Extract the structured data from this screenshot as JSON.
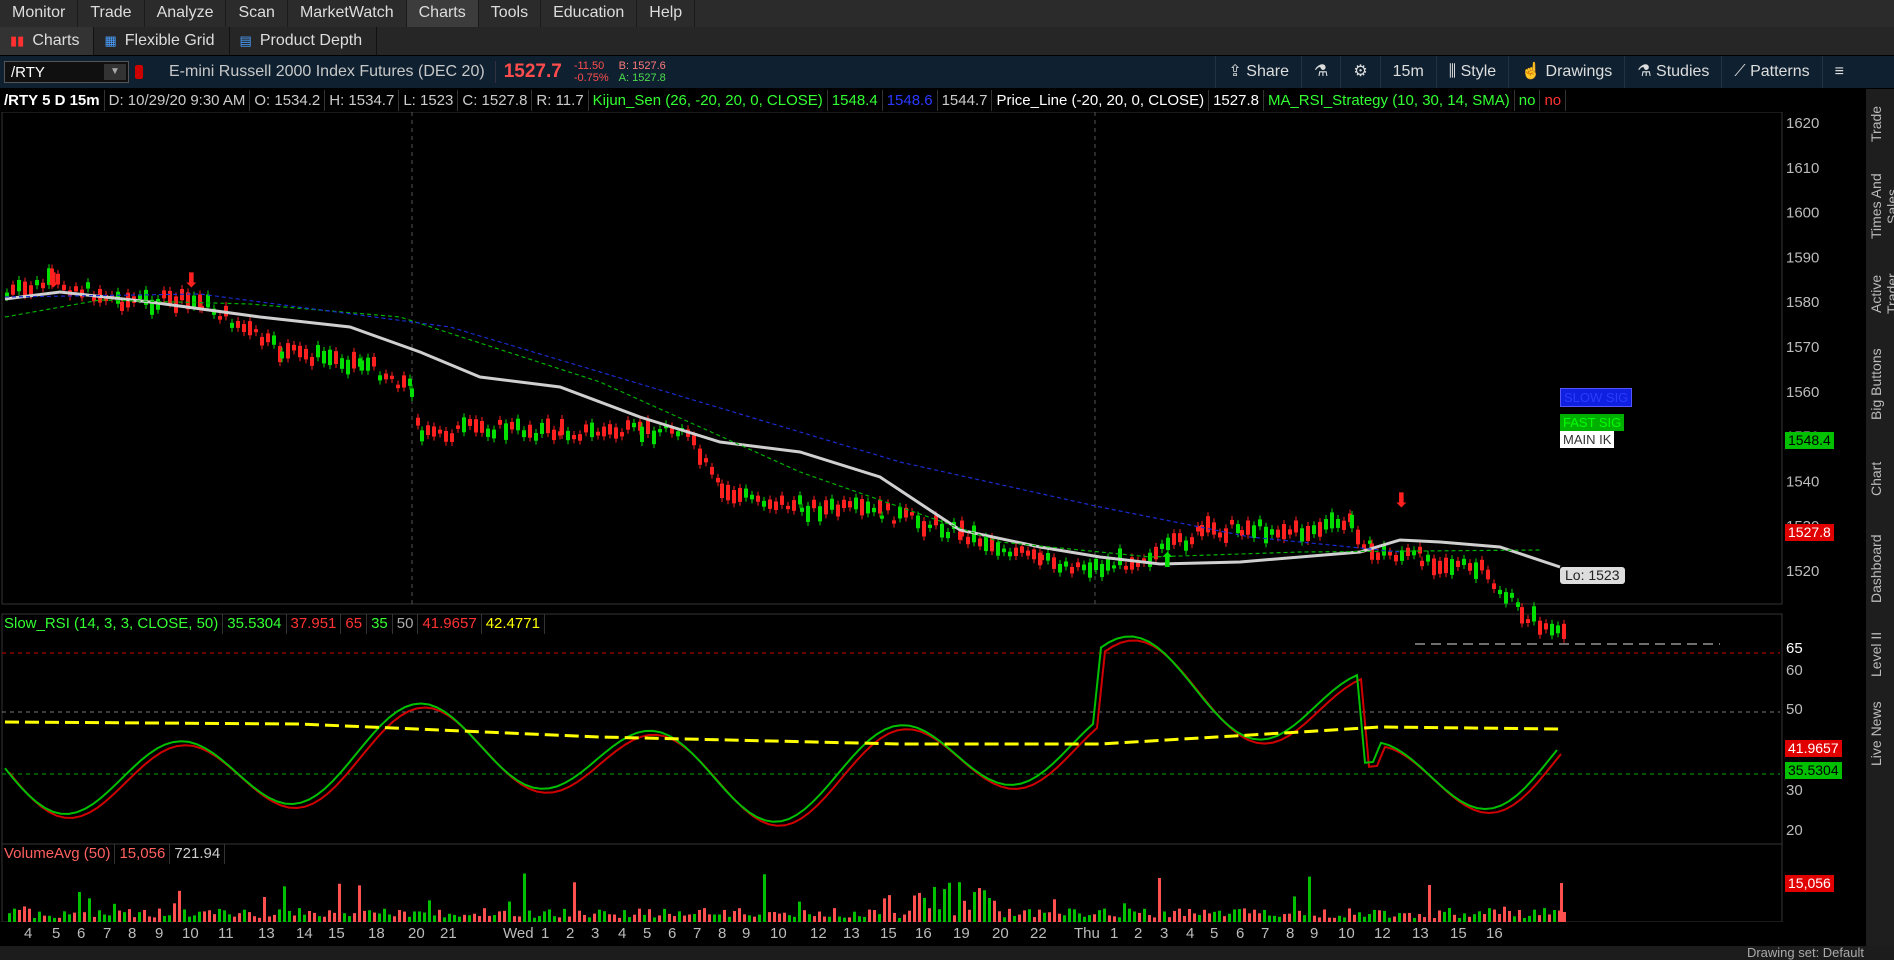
{
  "menu": [
    "Monitor",
    "Trade",
    "Analyze",
    "Scan",
    "MarketWatch",
    "Charts",
    "Tools",
    "Education",
    "Help"
  ],
  "active_menu": "Charts",
  "subtabs": [
    {
      "label": "Charts",
      "icon": "bar-chart-icon"
    },
    {
      "label": "Flexible Grid",
      "icon": "grid-icon"
    },
    {
      "label": "Product Depth",
      "icon": "depth-icon"
    }
  ],
  "toolbar": {
    "symbol": "/RTY",
    "description": "E-mini Russell 2000 Index Futures (DEC 20)",
    "last": "1527.7",
    "change": "-11.50",
    "change_pct": "-0.75%",
    "bid": "B: 1527.6",
    "ask": "A: 1527.8",
    "share": "Share",
    "timeframe": "15m",
    "style": "Style",
    "drawings": "Drawings",
    "studies": "Studies",
    "patterns": "Patterns"
  },
  "info": {
    "title": "/RTY 5 D 15m",
    "date": "D: 10/29/20 9:30 AM",
    "open": "O: 1534.2",
    "high": "H: 1534.7",
    "low": "L: 1523",
    "close": "C: 1527.8",
    "range": "R: 11.7",
    "kijun": "Kijun_Sen (26, -20, 20, 0, CLOSE)",
    "kijun_v1": "1548.4",
    "kijun_v2": "1548.6",
    "kijun_v3": "1544.7",
    "price_line": "Price_Line (-20, 20, 0, CLOSE)",
    "price_line_v": "1527.8",
    "strategy": "MA_RSI_Strategy (10, 30, 14, SMA)",
    "strategy_v1": "no",
    "strategy_v2": "no"
  },
  "price_axis": [
    "1620",
    "1610",
    "1600",
    "1590",
    "1580",
    "1570",
    "1560",
    "1550",
    "1540",
    "1530",
    "1520"
  ],
  "tags": {
    "kijun": "1548.4",
    "last": "1527.8",
    "low": "Lo: 1523",
    "slow": "SLOW SIG",
    "fast": "FAST SIG",
    "main": "MAIN IK"
  },
  "rsi": {
    "label": "Slow_RSI (14, 3, 3, CLOSE, 50)",
    "v1": "35.5304",
    "v2": "37.951",
    "v3": "65",
    "v4": "35",
    "v5": "50",
    "v6": "41.9657",
    "v7": "42.4771",
    "axis": [
      "65",
      "60",
      "50",
      "30",
      "20"
    ],
    "tag_red": "41.9657",
    "tag_green": "35.5304"
  },
  "volume": {
    "label": "VolumeAvg (50)",
    "v1": "15,056",
    "v2": "721.94",
    "tag": "15,056"
  },
  "x_axis": [
    "4",
    "5",
    "6",
    "7",
    "8",
    "9",
    "10",
    "11",
    "13",
    "14",
    "15",
    "18",
    "20",
    "21",
    "Wed",
    "1",
    "2",
    "3",
    "4",
    "5",
    "6",
    "7",
    "8",
    "9",
    "10",
    "12",
    "13",
    "15",
    "16",
    "19",
    "20",
    "22",
    "Thu",
    "1",
    "2",
    "3",
    "4",
    "5",
    "6",
    "7",
    "8",
    "9",
    "10",
    "12",
    "13",
    "15",
    "16"
  ],
  "side_tabs": [
    "Trade",
    "Times And Sales",
    "Active Trader",
    "Big Buttons",
    "Chart",
    "Dashboard",
    "Level II",
    "Live News"
  ],
  "bottom": {
    "drawing_set": "Drawing set: Default"
  },
  "colors": {
    "up": "#00d000",
    "down": "#ff2020",
    "kijun": "#cfcfcf",
    "yellow": "#ffff00"
  }
}
